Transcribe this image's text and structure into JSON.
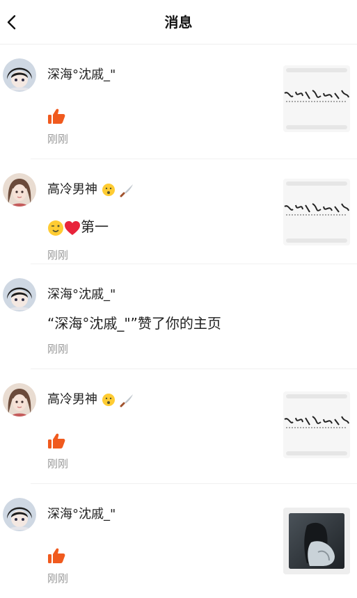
{
  "header": {
    "title": "消息"
  },
  "items": [
    {
      "name": "深海°沈戚_\"",
      "content": "",
      "time": "刚刚",
      "type": "like"
    },
    {
      "name": "高冷男神",
      "content": "第一",
      "time": "刚刚",
      "type": "comment"
    },
    {
      "name": "深海°沈戚_\"",
      "content": "“深海°沈戚_\"”赞了你的主页",
      "time": "刚刚",
      "type": "profile"
    },
    {
      "name": "高冷男神",
      "content": "",
      "time": "刚刚",
      "type": "like"
    },
    {
      "name": "深海°沈戚_\"",
      "content": "",
      "time": "刚刚",
      "type": "like"
    }
  ],
  "colors": {
    "like": "#f05a1e",
    "heart": "#e8243b",
    "muted": "#999999"
  }
}
